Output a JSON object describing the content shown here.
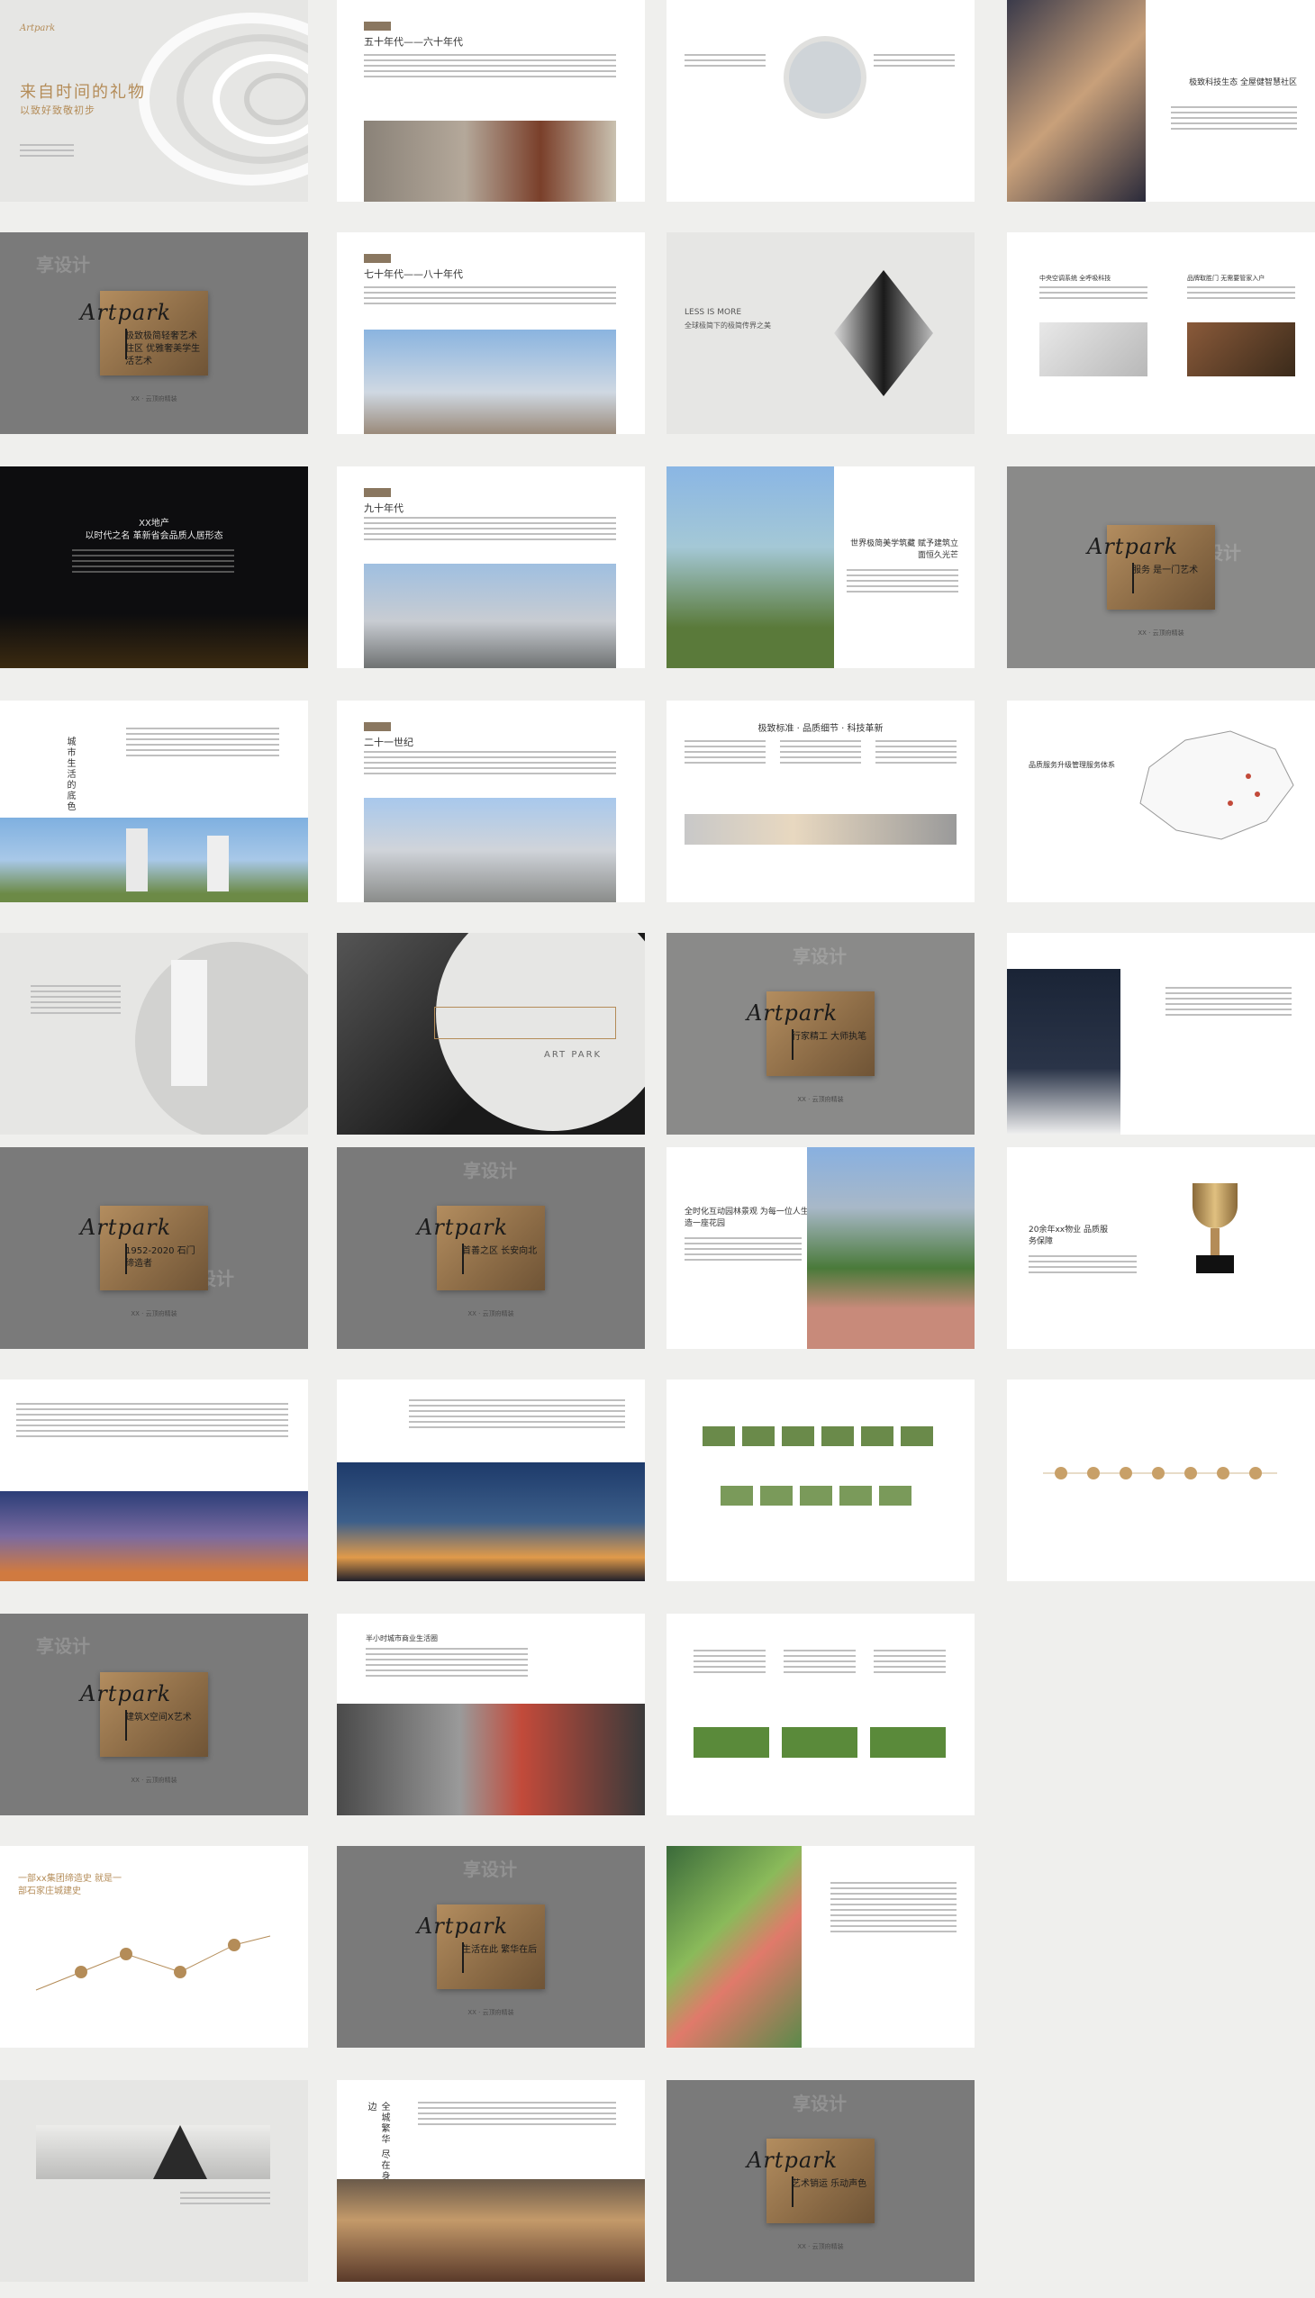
{
  "cover": {
    "logo": "Artpark",
    "title": "来自时间的礼物",
    "subtitle": "以致好致敬初步"
  },
  "watermark": "享设计",
  "plates": [
    {
      "tag": "极致极简轻奢艺术住区 优雅奢美学生活艺术",
      "footer": "XX · 云顶府精装"
    },
    {
      "tag": "服务 是一门艺术",
      "footer": "XX · 云顶府精装"
    },
    {
      "tag": "行家精工 大师执笔",
      "footer": "XX · 云顶府精装"
    },
    {
      "tag": "1952-2020 石门缔造者",
      "footer": "XX · 云顶府精装"
    },
    {
      "tag": "首善之区 长安向北",
      "footer": "XX · 云顶府精装"
    },
    {
      "tag": "建筑X空间X艺术",
      "footer": "XX · 云顶府精装"
    },
    {
      "tag": "生活在此 繁华在后",
      "footer": "XX · 云顶府精装"
    },
    {
      "tag": "艺术销运 乐动声色",
      "footer": "XX · 云顶府精装"
    }
  ],
  "pages": {
    "p_50s": "五十年代——六十年代",
    "p_70s": "七十年代——八十年代",
    "p_90s": "九十年代",
    "p_21c": "二十一世纪",
    "less": "LESS IS MORE",
    "less_sub": "全球极简下的极简传界之美",
    "world": "世界极简美学筑藏 赋予建筑立面恒久光芒",
    "tech": "极致科技生态 全屋健智慧社区",
    "center": "中央空调系统 全呼吸科技",
    "inner": "品牌取胜门 无需要管家入户",
    "xx_estate": "XX地产",
    "xx_estate_sub": "以时代之名 革新省会品质人居形态",
    "green": "城市生活的底色",
    "standard": "极致标准 · 品质细节 · 科技革新",
    "art_park": "ART PARK",
    "map_title": "品质服务升级管理服务体系",
    "guard": "全时化互动园林景观 为每一位人生造一座花园",
    "award": "20余年xx物业 品质服务保障",
    "sub_line": "一部xx集团缔造史 就是一部石家庄城建史",
    "traffic": "半小时城市商业生活圈",
    "mall": "全城繁华 尽在身边"
  }
}
